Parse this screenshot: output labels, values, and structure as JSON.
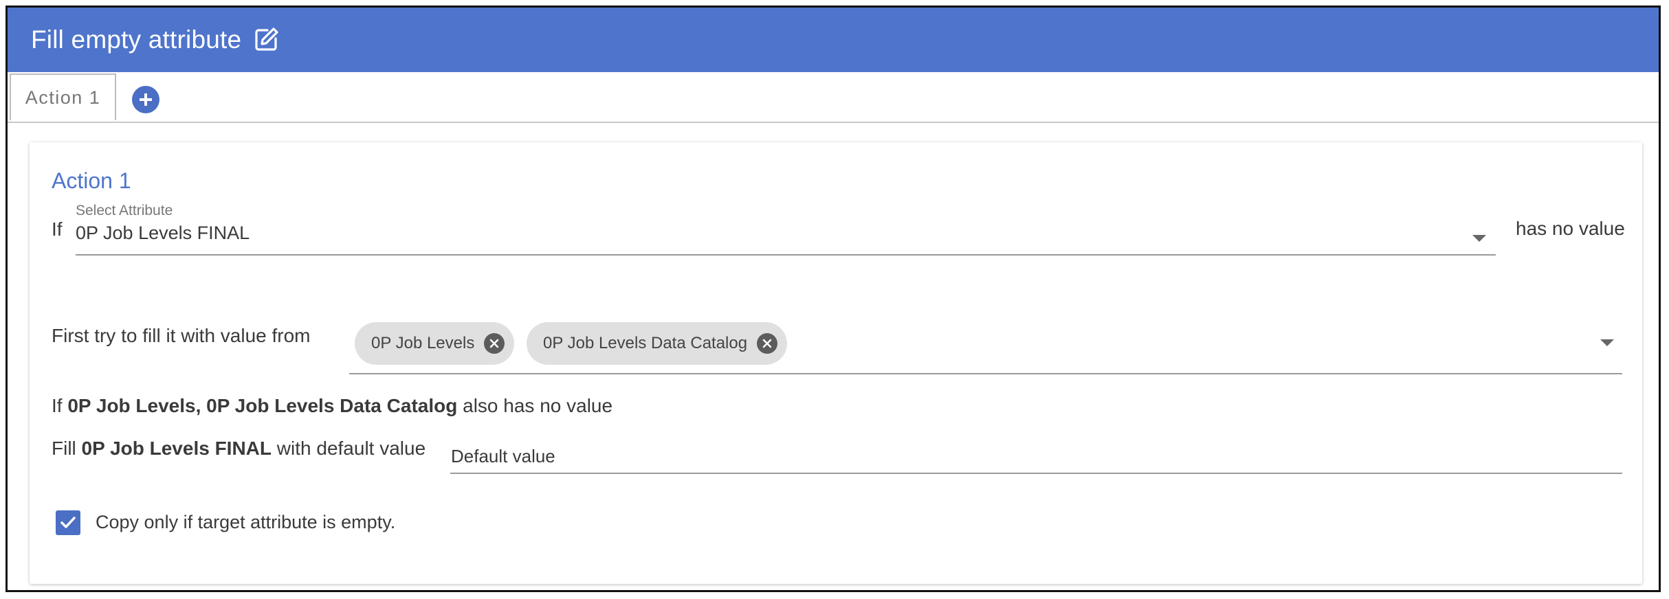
{
  "header": {
    "title": "Fill empty attribute",
    "edit_icon": "edit-icon",
    "background": "#4f74cb"
  },
  "tabs": [
    {
      "label": "Action 1",
      "active": true
    }
  ],
  "add_tab_icon": "plus-circle-icon",
  "action": {
    "title": "Action 1",
    "if_prefix": "If",
    "select_attribute": {
      "label": "Select Attribute",
      "value": "0P Job Levels FINAL"
    },
    "has_no_value": "has no value",
    "first_try_label": "First try to fill it with value from",
    "sources": [
      {
        "label": "0P Job Levels"
      },
      {
        "label": "0P Job Levels Data Catalog"
      }
    ],
    "fallback": {
      "prefix": "If",
      "sources_bold": "0P Job Levels, 0P Job Levels Data Catalog",
      "suffix": "also has no value"
    },
    "fill_default": {
      "prefix": "Fill",
      "target_bold": "0P Job Levels FINAL",
      "suffix": "with default value",
      "input_value": "Default value"
    },
    "copy_only": {
      "checked": true,
      "label": "Copy only if target attribute is empty."
    }
  },
  "accent": "#4a6fc4"
}
